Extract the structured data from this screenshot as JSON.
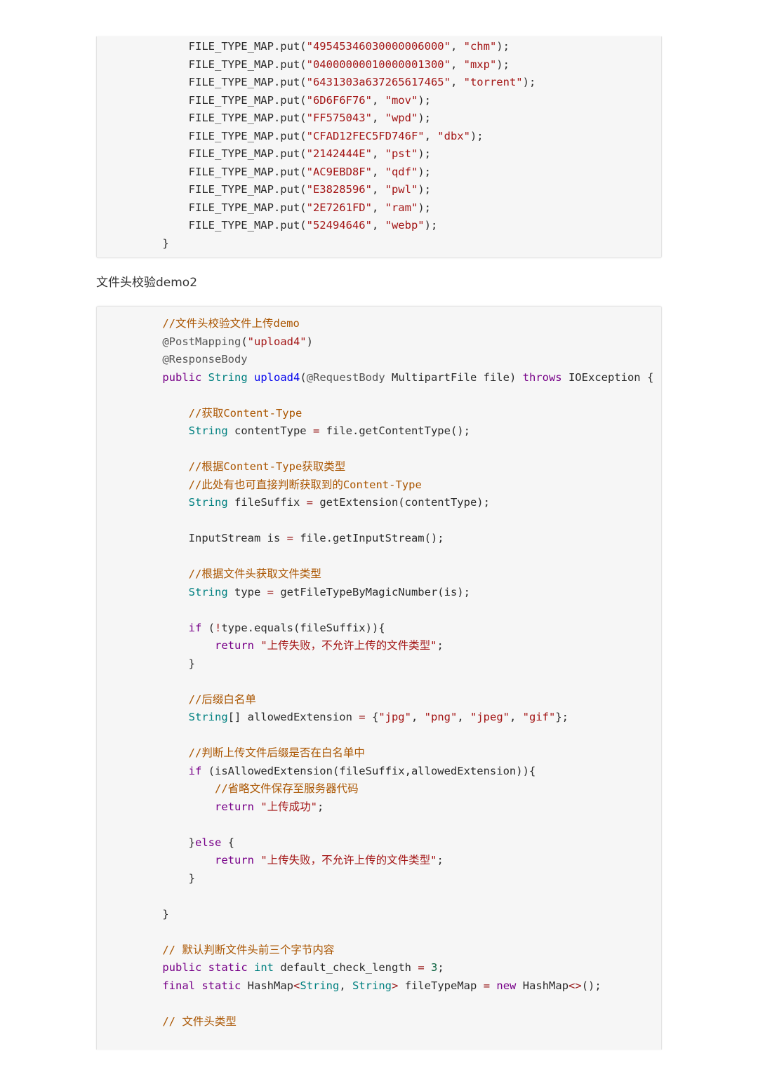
{
  "block1_lines": [
    [
      [
        "        ",
        "plain"
      ],
      [
        "FILE_TYPE_MAP.put(",
        "plain"
      ],
      [
        "\"49545346030000006000\"",
        "str"
      ],
      [
        ", ",
        "plain"
      ],
      [
        "\"chm\"",
        "str"
      ],
      [
        ");",
        "plain"
      ]
    ],
    [
      [
        "        ",
        "plain"
      ],
      [
        "FILE_TYPE_MAP.put(",
        "plain"
      ],
      [
        "\"04000000010000001300\"",
        "str"
      ],
      [
        ", ",
        "plain"
      ],
      [
        "\"mxp\"",
        "str"
      ],
      [
        ");",
        "plain"
      ]
    ],
    [
      [
        "        ",
        "plain"
      ],
      [
        "FILE_TYPE_MAP.put(",
        "plain"
      ],
      [
        "\"6431303a637265617465\"",
        "str"
      ],
      [
        ", ",
        "plain"
      ],
      [
        "\"torrent\"",
        "str"
      ],
      [
        ");",
        "plain"
      ]
    ],
    [
      [
        "        ",
        "plain"
      ],
      [
        "FILE_TYPE_MAP.put(",
        "plain"
      ],
      [
        "\"6D6F6F76\"",
        "str"
      ],
      [
        ", ",
        "plain"
      ],
      [
        "\"mov\"",
        "str"
      ],
      [
        ");",
        "plain"
      ]
    ],
    [
      [
        "        ",
        "plain"
      ],
      [
        "FILE_TYPE_MAP.put(",
        "plain"
      ],
      [
        "\"FF575043\"",
        "str"
      ],
      [
        ", ",
        "plain"
      ],
      [
        "\"wpd\"",
        "str"
      ],
      [
        ");",
        "plain"
      ]
    ],
    [
      [
        "        ",
        "plain"
      ],
      [
        "FILE_TYPE_MAP.put(",
        "plain"
      ],
      [
        "\"CFAD12FEC5FD746F\"",
        "str"
      ],
      [
        ", ",
        "plain"
      ],
      [
        "\"dbx\"",
        "str"
      ],
      [
        ");",
        "plain"
      ]
    ],
    [
      [
        "        ",
        "plain"
      ],
      [
        "FILE_TYPE_MAP.put(",
        "plain"
      ],
      [
        "\"2142444E\"",
        "str"
      ],
      [
        ", ",
        "plain"
      ],
      [
        "\"pst\"",
        "str"
      ],
      [
        ");",
        "plain"
      ]
    ],
    [
      [
        "        ",
        "plain"
      ],
      [
        "FILE_TYPE_MAP.put(",
        "plain"
      ],
      [
        "\"AC9EBD8F\"",
        "str"
      ],
      [
        ", ",
        "plain"
      ],
      [
        "\"qdf\"",
        "str"
      ],
      [
        ");",
        "plain"
      ]
    ],
    [
      [
        "        ",
        "plain"
      ],
      [
        "FILE_TYPE_MAP.put(",
        "plain"
      ],
      [
        "\"E3828596\"",
        "str"
      ],
      [
        ", ",
        "plain"
      ],
      [
        "\"pwl\"",
        "str"
      ],
      [
        ");",
        "plain"
      ]
    ],
    [
      [
        "        ",
        "plain"
      ],
      [
        "FILE_TYPE_MAP.put(",
        "plain"
      ],
      [
        "\"2E7261FD\"",
        "str"
      ],
      [
        ", ",
        "plain"
      ],
      [
        "\"ram\"",
        "str"
      ],
      [
        ");",
        "plain"
      ]
    ],
    [
      [
        "        ",
        "plain"
      ],
      [
        "FILE_TYPE_MAP.put(",
        "plain"
      ],
      [
        "\"52494646\"",
        "str"
      ],
      [
        ", ",
        "plain"
      ],
      [
        "\"webp\"",
        "str"
      ],
      [
        ");",
        "plain"
      ]
    ],
    [
      [
        "    ",
        "plain"
      ],
      [
        "}",
        "plain"
      ]
    ]
  ],
  "heading": "文件头校验demo2",
  "block2_lines": [
    [
      [
        "    ",
        "plain"
      ],
      [
        "//文件头校验文件上传demo",
        "com"
      ]
    ],
    [
      [
        "    ",
        "plain"
      ],
      [
        "@PostMapping",
        "ann"
      ],
      [
        "(",
        "plain"
      ],
      [
        "\"upload4\"",
        "str"
      ],
      [
        ")",
        "plain"
      ]
    ],
    [
      [
        "    ",
        "plain"
      ],
      [
        "@ResponseBody",
        "ann"
      ]
    ],
    [
      [
        "    ",
        "plain"
      ],
      [
        "public",
        "kw"
      ],
      [
        " ",
        "plain"
      ],
      [
        "String",
        "type"
      ],
      [
        " ",
        "plain"
      ],
      [
        "upload4",
        "fn"
      ],
      [
        "(",
        "plain"
      ],
      [
        "@RequestBody",
        "ann"
      ],
      [
        " MultipartFile file) ",
        "plain"
      ],
      [
        "throws",
        "kw"
      ],
      [
        " IOException {",
        "plain"
      ]
    ],
    [],
    [
      [
        "        ",
        "plain"
      ],
      [
        "//获取Content-Type",
        "com"
      ]
    ],
    [
      [
        "        ",
        "plain"
      ],
      [
        "String",
        "type"
      ],
      [
        " contentType ",
        "plain"
      ],
      [
        "=",
        "op"
      ],
      [
        " file.getContentType();",
        "plain"
      ]
    ],
    [],
    [
      [
        "        ",
        "plain"
      ],
      [
        "//根据Content-Type获取类型",
        "com"
      ]
    ],
    [
      [
        "        ",
        "plain"
      ],
      [
        "//此处有也可直接判断获取到的Content-Type",
        "com"
      ]
    ],
    [
      [
        "        ",
        "plain"
      ],
      [
        "String",
        "type"
      ],
      [
        " fileSuffix ",
        "plain"
      ],
      [
        "=",
        "op"
      ],
      [
        " getExtension(contentType);",
        "plain"
      ]
    ],
    [],
    [
      [
        "        ",
        "plain"
      ],
      [
        "InputStream is ",
        "plain"
      ],
      [
        "=",
        "op"
      ],
      [
        " file.getInputStream();",
        "plain"
      ]
    ],
    [],
    [
      [
        "        ",
        "plain"
      ],
      [
        "//根据文件头获取文件类型",
        "com"
      ]
    ],
    [
      [
        "        ",
        "plain"
      ],
      [
        "String",
        "type"
      ],
      [
        " type ",
        "plain"
      ],
      [
        "=",
        "op"
      ],
      [
        " getFileTypeByMagicNumber(is);",
        "plain"
      ]
    ],
    [],
    [
      [
        "        ",
        "plain"
      ],
      [
        "if",
        "kw"
      ],
      [
        " (",
        "plain"
      ],
      [
        "!",
        "op"
      ],
      [
        "type.equals(fileSuffix)){",
        "plain"
      ]
    ],
    [
      [
        "            ",
        "plain"
      ],
      [
        "return",
        "kw"
      ],
      [
        " ",
        "plain"
      ],
      [
        "\"上传失败，不允许上传的文件类型\"",
        "str"
      ],
      [
        ";",
        "plain"
      ]
    ],
    [
      [
        "        ",
        "plain"
      ],
      [
        "}",
        "plain"
      ]
    ],
    [],
    [
      [
        "        ",
        "plain"
      ],
      [
        "//后缀白名单",
        "com"
      ]
    ],
    [
      [
        "        ",
        "plain"
      ],
      [
        "String",
        "type"
      ],
      [
        "[] allowedExtension ",
        "plain"
      ],
      [
        "=",
        "op"
      ],
      [
        " {",
        "plain"
      ],
      [
        "\"jpg\"",
        "str"
      ],
      [
        ", ",
        "plain"
      ],
      [
        "\"png\"",
        "str"
      ],
      [
        ", ",
        "plain"
      ],
      [
        "\"jpeg\"",
        "str"
      ],
      [
        ", ",
        "plain"
      ],
      [
        "\"gif\"",
        "str"
      ],
      [
        "};",
        "plain"
      ]
    ],
    [],
    [
      [
        "        ",
        "plain"
      ],
      [
        "//判断上传文件后缀是否在白名单中",
        "com"
      ]
    ],
    [
      [
        "        ",
        "plain"
      ],
      [
        "if",
        "kw"
      ],
      [
        " (isAllowedExtension(fileSuffix,allowedExtension)){",
        "plain"
      ]
    ],
    [
      [
        "            ",
        "plain"
      ],
      [
        "//省略文件保存至服务器代码",
        "com"
      ]
    ],
    [
      [
        "            ",
        "plain"
      ],
      [
        "return",
        "kw"
      ],
      [
        " ",
        "plain"
      ],
      [
        "\"上传成功\"",
        "str"
      ],
      [
        ";",
        "plain"
      ]
    ],
    [],
    [
      [
        "        ",
        "plain"
      ],
      [
        "}",
        "plain"
      ],
      [
        "else",
        "kw"
      ],
      [
        " {",
        "plain"
      ]
    ],
    [
      [
        "            ",
        "plain"
      ],
      [
        "return",
        "kw"
      ],
      [
        " ",
        "plain"
      ],
      [
        "\"上传失败，不允许上传的文件类型\"",
        "str"
      ],
      [
        ";",
        "plain"
      ]
    ],
    [
      [
        "        ",
        "plain"
      ],
      [
        "}",
        "plain"
      ]
    ],
    [],
    [
      [
        "    ",
        "plain"
      ],
      [
        "}",
        "plain"
      ]
    ],
    [],
    [
      [
        "    ",
        "plain"
      ],
      [
        "// 默认判断文件头前三个字节内容",
        "com"
      ]
    ],
    [
      [
        "    ",
        "plain"
      ],
      [
        "public",
        "kw"
      ],
      [
        " ",
        "plain"
      ],
      [
        "static",
        "kw"
      ],
      [
        " ",
        "plain"
      ],
      [
        "int",
        "type"
      ],
      [
        " default_check_length ",
        "plain"
      ],
      [
        "=",
        "op"
      ],
      [
        " ",
        "plain"
      ],
      [
        "3",
        "num"
      ],
      [
        ";",
        "plain"
      ]
    ],
    [
      [
        "    ",
        "plain"
      ],
      [
        "final",
        "kw"
      ],
      [
        " ",
        "plain"
      ],
      [
        "static",
        "kw"
      ],
      [
        " HashMap",
        "plain"
      ],
      [
        "<",
        "op"
      ],
      [
        "String",
        "type"
      ],
      [
        ", ",
        "plain"
      ],
      [
        "String",
        "type"
      ],
      [
        ">",
        "op"
      ],
      [
        " fileTypeMap ",
        "plain"
      ],
      [
        "=",
        "op"
      ],
      [
        " ",
        "plain"
      ],
      [
        "new",
        "kw"
      ],
      [
        " HashMap",
        "plain"
      ],
      [
        "<>",
        "op"
      ],
      [
        "();",
        "plain"
      ]
    ],
    [],
    [
      [
        "    ",
        "plain"
      ],
      [
        "// 文件头类型",
        "com"
      ]
    ]
  ]
}
